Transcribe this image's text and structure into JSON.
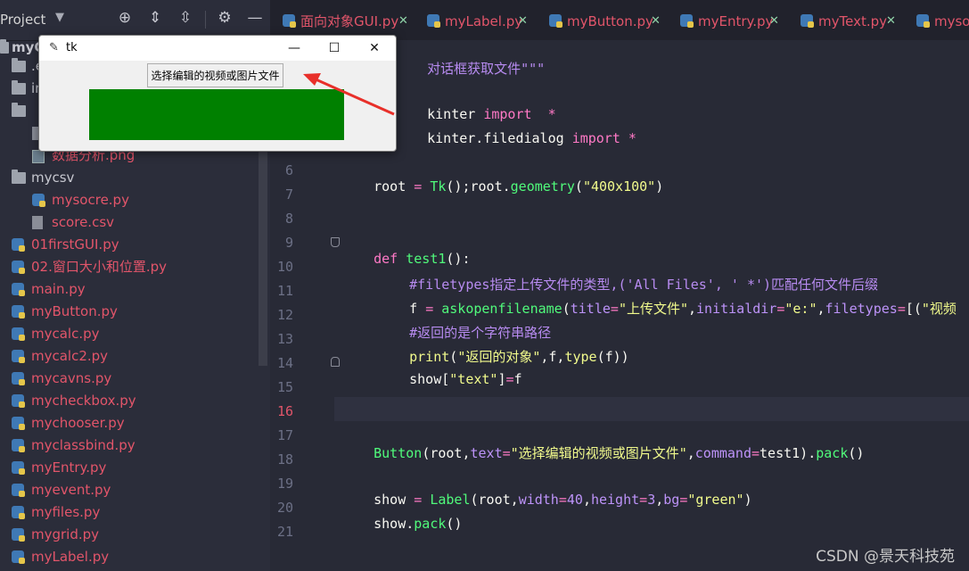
{
  "project": {
    "title": "Project",
    "root_label": "myG",
    "tree": [
      {
        "label": ".e",
        "kind": "folder",
        "color": "gray"
      },
      {
        "label": "in",
        "kind": "folder",
        "color": "gray"
      },
      {
        "label": "",
        "kind": "folder",
        "color": "gray"
      },
      {
        "label": "",
        "kind": "file",
        "color": "gray"
      },
      {
        "label": "数据分析.png",
        "kind": "png",
        "color": "red"
      },
      {
        "label": "mycsv",
        "kind": "folder",
        "color": "gray"
      },
      {
        "label": "mysocre.py",
        "kind": "py",
        "color": "red"
      },
      {
        "label": "score.csv",
        "kind": "csv",
        "color": "red"
      },
      {
        "label": "01firstGUI.py",
        "kind": "py",
        "color": "red"
      },
      {
        "label": "02.窗口大小和位置.py",
        "kind": "py",
        "color": "red"
      },
      {
        "label": "main.py",
        "kind": "py",
        "color": "red"
      },
      {
        "label": "myButton.py",
        "kind": "py",
        "color": "red"
      },
      {
        "label": "mycalc.py",
        "kind": "py",
        "color": "red"
      },
      {
        "label": "mycalc2.py",
        "kind": "py",
        "color": "red"
      },
      {
        "label": "mycavns.py",
        "kind": "py",
        "color": "red"
      },
      {
        "label": "mycheckbox.py",
        "kind": "py",
        "color": "red"
      },
      {
        "label": "mychooser.py",
        "kind": "py",
        "color": "red"
      },
      {
        "label": "myclassbind.py",
        "kind": "py",
        "color": "red"
      },
      {
        "label": "myEntry.py",
        "kind": "py",
        "color": "red"
      },
      {
        "label": "myevent.py",
        "kind": "py",
        "color": "red"
      },
      {
        "label": "myfiles.py",
        "kind": "py",
        "color": "red"
      },
      {
        "label": "mygrid.py",
        "kind": "py",
        "color": "red"
      },
      {
        "label": "myLabel.py",
        "kind": "py",
        "color": "red"
      }
    ]
  },
  "tabs": [
    {
      "label": "面向对象GUI.py"
    },
    {
      "label": "myLabel.py"
    },
    {
      "label": "myButton.py"
    },
    {
      "label": "myEntry.py"
    },
    {
      "label": "myText.py"
    },
    {
      "label": "mysoc"
    }
  ],
  "editor": {
    "current_line": "16",
    "line_numbers": [
      "6",
      "7",
      "8",
      "9",
      "10",
      "11",
      "12",
      "13",
      "14",
      "15",
      "16",
      "17",
      "18",
      "19",
      "20",
      "21"
    ],
    "code": {
      "l_doc": "对话框获取文件\"\"\"",
      "l3_a": "kinter ",
      "l3_kw": "import",
      "l3_star": "  *",
      "l4_a": "kinter.filedialog ",
      "l4_kw": "import",
      "l4_star": " *",
      "l6_a": "root ",
      "l6_eq": "=",
      "l6_b": " ",
      "l6_tk": "Tk",
      "l6_c": "();root.",
      "l6_geo": "geometry",
      "l6_d": "(",
      "l6_s": "\"400x100\"",
      "l6_e": ")",
      "l9_def": "def",
      "l9_sp": " ",
      "l9_fn": "test1",
      "l9_rest": "():",
      "l10": "#filetypes指定上传文件的类型,('All Files', ' *')匹配任何文件后缀",
      "l11_a": "f ",
      "l11_eq": "=",
      "l11_sp": " ",
      "l11_fn": "askopenfilename",
      "l11_p": "(",
      "l11_t": "title",
      "l11_eq2": "=",
      "l11_s1": "\"上传文件\"",
      "l11_c1": ",",
      "l11_i": "initialdir",
      "l11_eq3": "=",
      "l11_s2": "\"e:\"",
      "l11_c2": ",",
      "l11_ft": "filetypes",
      "l11_eq4": "=",
      "l11_r": "[(",
      "l11_s3": "\"视频",
      "l12": "#返回的是个字符串路径",
      "l13_fn": "print",
      "l13_p": "(",
      "l13_s": "\"返回的对象\"",
      "l13_m": ",f,",
      "l13_ty": "type",
      "l13_r": "(f))",
      "l14_a": "show[",
      "l14_s": "\"text\"",
      "l14_b": "]",
      "l14_eq": "=",
      "l14_c": "f",
      "l17_fn": "Button",
      "l17_a": "(root,",
      "l17_t": "text",
      "l17_eq": "=",
      "l17_s": "\"选择编辑的视频或图片文件\"",
      "l17_c": ",",
      "l17_cm": "command",
      "l17_eq2": "=",
      "l17_d": "test1).",
      "l17_pk": "pack",
      "l17_e": "()",
      "l19_a": "show ",
      "l19_eq": "=",
      "l19_sp": " ",
      "l19_fn": "Label",
      "l19_b": "(root,",
      "l19_w": "width",
      "l19_eq2": "=",
      "l19_n1": "40",
      "l19_c": ",",
      "l19_h": "height",
      "l19_eq3": "=",
      "l19_n2": "3",
      "l19_c2": ",",
      "l19_bg": "bg",
      "l19_eq4": "=",
      "l19_s": "\"green\"",
      "l19_e": ")",
      "l20_a": "show.",
      "l20_pk": "pack",
      "l20_b": "()"
    }
  },
  "tk_window": {
    "title": "tk",
    "feather_icon": "✎",
    "button_label": "选择编辑的视频或图片文件",
    "label_color": "#008000",
    "minimize": "—",
    "maximize": "☐",
    "close": "✕"
  },
  "annotation_arrow_color": "#e8302a",
  "watermark": "CSDN @景天科技苑"
}
